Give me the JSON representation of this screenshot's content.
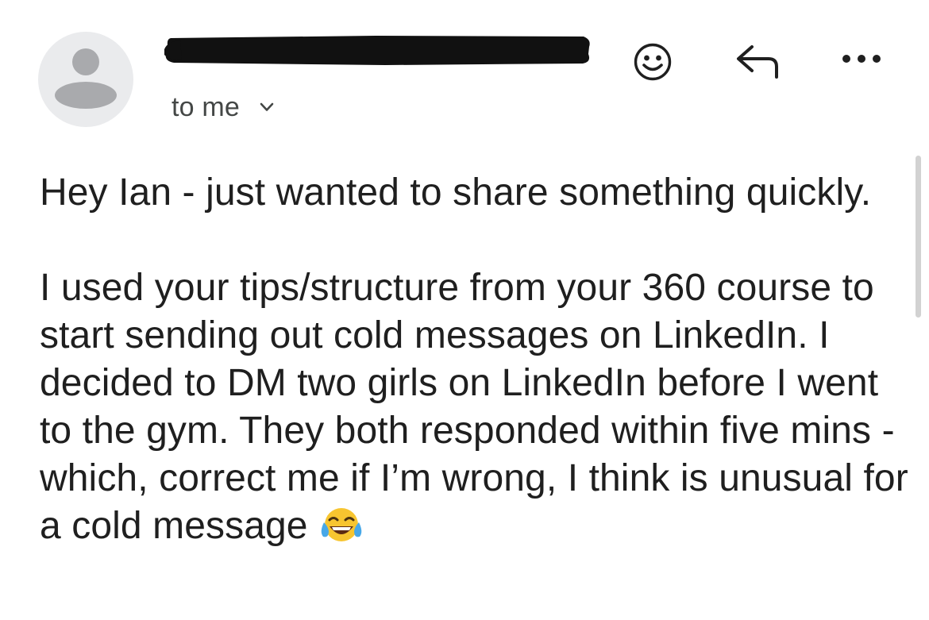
{
  "header": {
    "recipient_label": "to me",
    "sender_name": "",
    "actions": {
      "emoji": "smiley-icon",
      "reply": "reply-icon",
      "more": "more-horizontal-icon"
    }
  },
  "message": {
    "greeting": "Hey Ian - just wanted to share something quickly.",
    "paragraph_1": "I used your tips/structure from your 360 course to start sending out cold messages on LinkedIn. I decided to DM two girls on LinkedIn before I went to the gym. They both responded within five mins - which, correct me if I’m wrong, I think is unusual for a cold message",
    "emoji": "face-with-tears-of-joy"
  },
  "colors": {
    "text": "#1f1f1f",
    "secondary_text": "#444746",
    "avatar_bg": "#eaebed",
    "avatar_fg": "#a9aaad",
    "redaction": "#111111"
  }
}
